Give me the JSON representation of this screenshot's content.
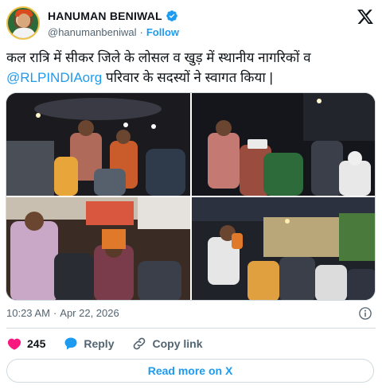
{
  "author": {
    "display_name": "HANUMAN BENIWAL",
    "handle": "@hanumanbeniwal",
    "separator": "·",
    "follow_label": "Follow",
    "verified": true,
    "avatar_icon": "profile-photo"
  },
  "tweet": {
    "text_before_mention": "कल रात्रि में सीकर जिले के लोसल व खुड़ में स्थानीय नागरिकों व ",
    "mention": "@RLPINDIAorg",
    "text_after_mention": " परिवार के सदस्यों ने स्वागत किया |"
  },
  "media": {
    "photos": [
      {
        "description_icon": "crowd-night-photo"
      },
      {
        "description_icon": "crowd-night-photo"
      },
      {
        "description_icon": "crowd-market-photo"
      },
      {
        "description_icon": "crowd-street-photo"
      }
    ]
  },
  "meta": {
    "time": "10:23 AM",
    "separator": "·",
    "date": "Apr 22, 2026"
  },
  "actions": {
    "like_count": "245",
    "reply_label": "Reply",
    "copy_link_label": "Copy link"
  },
  "read_more_label": "Read more on X",
  "colors": {
    "accent": "#1d9bf0",
    "like": "#f91880",
    "text": "#0f1419",
    "secondary": "#536471",
    "border": "#cfd9de"
  }
}
